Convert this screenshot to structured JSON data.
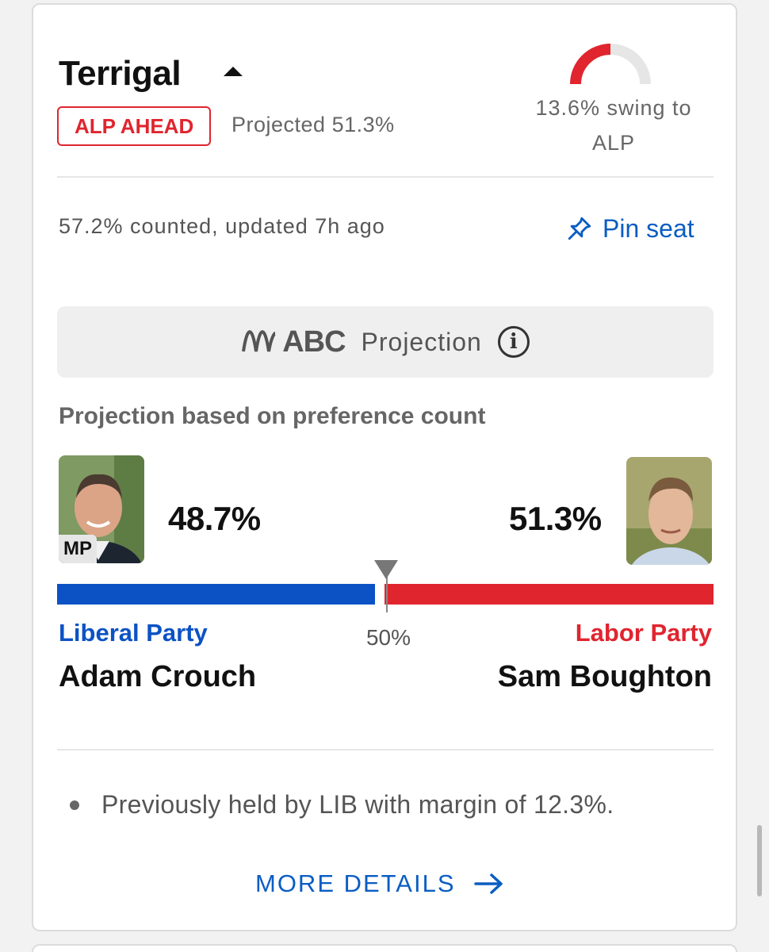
{
  "seat": {
    "name": "Terrigal",
    "status_badge": "ALP AHEAD",
    "projected": "Projected 51.3%",
    "swing_text": "13.6% swing to ALP",
    "swing_fraction": 0.136,
    "counted": "57.2% counted, updated 7h ago",
    "pin_label": "Pin seat"
  },
  "projection": {
    "brand": "ABC",
    "label": "Projection",
    "based_on": "Projection based on preference count",
    "midpoint_label": "50%"
  },
  "candidates": {
    "left": {
      "badge": "MP",
      "percent": "48.7%",
      "share": 48.7,
      "party": "Liberal Party",
      "name": "Adam Crouch"
    },
    "right": {
      "percent": "51.3%",
      "share": 51.3,
      "party": "Labor Party",
      "name": "Sam Boughton"
    }
  },
  "notes": [
    "Previously held by LIB with margin of 12.3%."
  ],
  "more_details_label": "MORE DETAILS",
  "colors": {
    "lib": "#0c52c4",
    "alp": "#e0252f",
    "link": "#0a5dc2"
  }
}
